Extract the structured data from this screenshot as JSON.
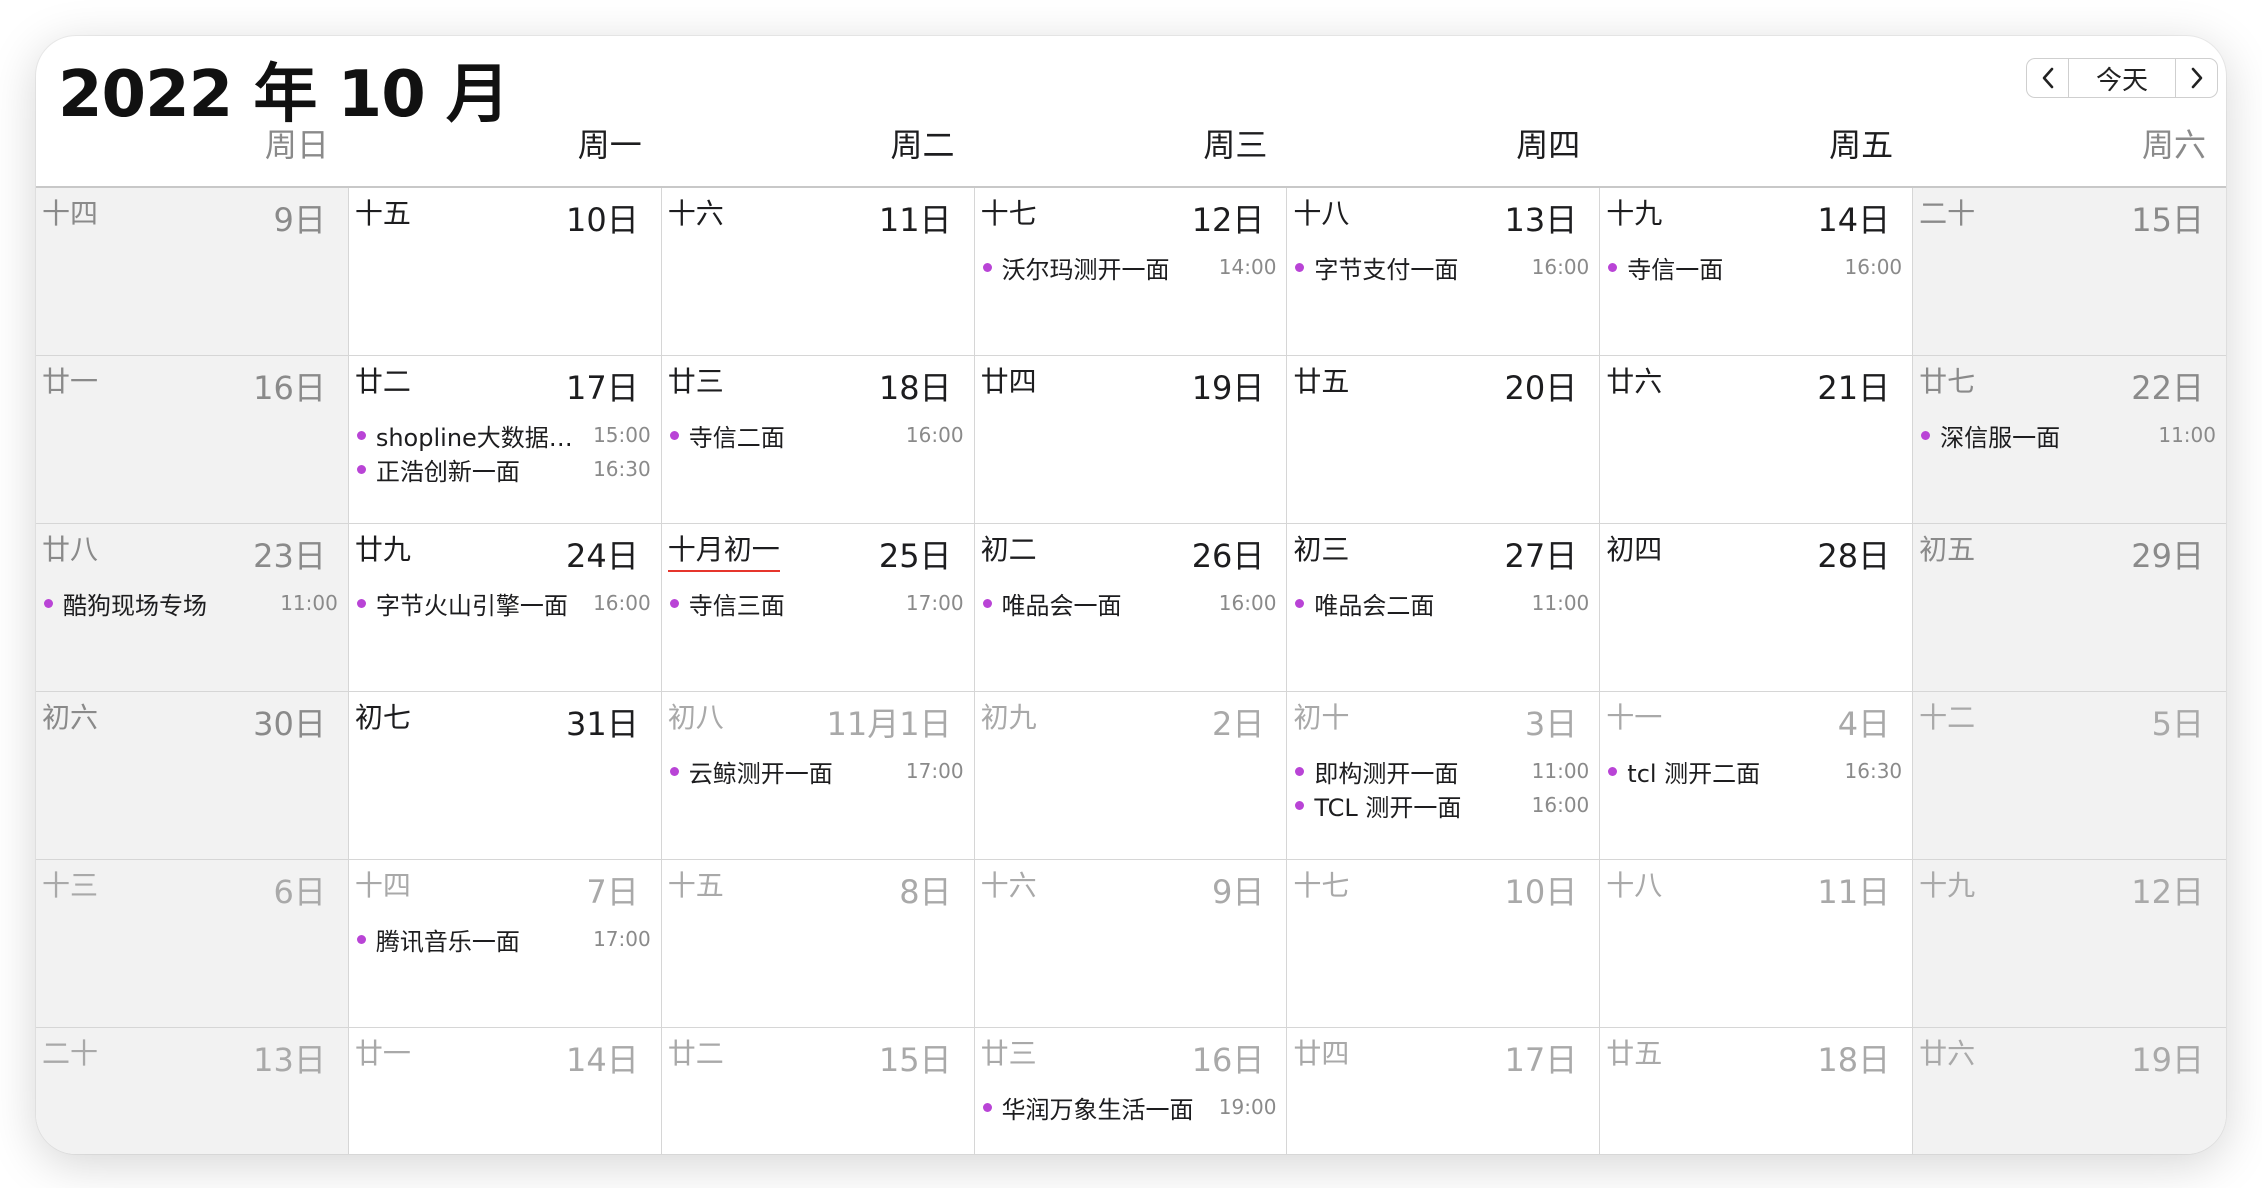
{
  "header": {
    "title": "2022 年 10 月",
    "today_label": "今天",
    "prev_icon": "chevron-left",
    "next_icon": "chevron-right"
  },
  "weekdays": [
    "周日",
    "周一",
    "周二",
    "周三",
    "周四",
    "周五",
    "周六"
  ],
  "colors": {
    "event_dot": "#b944d6",
    "lunar_first_underline": "#e6352c",
    "weekend_bg": "#f2f2f2"
  },
  "weeks": [
    {
      "days": [
        {
          "lunar": "十四",
          "day": "9日",
          "weekend": true,
          "events": []
        },
        {
          "lunar": "十五",
          "day": "10日",
          "events": []
        },
        {
          "lunar": "十六",
          "day": "11日",
          "events": []
        },
        {
          "lunar": "十七",
          "day": "12日",
          "events": [
            {
              "title": "沃尔玛测开一面",
              "time": "14:00"
            }
          ]
        },
        {
          "lunar": "十八",
          "day": "13日",
          "events": [
            {
              "title": "字节支付一面",
              "time": "16:00"
            }
          ]
        },
        {
          "lunar": "十九",
          "day": "14日",
          "events": [
            {
              "title": "寺信一面",
              "time": "16:00"
            }
          ]
        },
        {
          "lunar": "二十",
          "day": "15日",
          "weekend": true,
          "events": []
        }
      ]
    },
    {
      "days": [
        {
          "lunar": "廿一",
          "day": "16日",
          "weekend": true,
          "events": []
        },
        {
          "lunar": "廿二",
          "day": "17日",
          "events": [
            {
              "title": "shopline大数据…",
              "time": "15:00"
            },
            {
              "title": "正浩创新一面",
              "time": "16:30"
            }
          ]
        },
        {
          "lunar": "廿三",
          "day": "18日",
          "events": [
            {
              "title": "寺信二面",
              "time": "16:00"
            }
          ]
        },
        {
          "lunar": "廿四",
          "day": "19日",
          "events": []
        },
        {
          "lunar": "廿五",
          "day": "20日",
          "events": []
        },
        {
          "lunar": "廿六",
          "day": "21日",
          "events": []
        },
        {
          "lunar": "廿七",
          "day": "22日",
          "weekend": true,
          "events": [
            {
              "title": "深信服一面",
              "time": "11:00"
            }
          ]
        }
      ]
    },
    {
      "days": [
        {
          "lunar": "廿八",
          "day": "23日",
          "weekend": true,
          "events": [
            {
              "title": "酷狗现场专场",
              "time": "11:00"
            }
          ]
        },
        {
          "lunar": "廿九",
          "day": "24日",
          "events": [
            {
              "title": "字节火山引擎一面",
              "time": "16:00"
            }
          ]
        },
        {
          "lunar": "十月初一",
          "day": "25日",
          "lunar_first": true,
          "events": [
            {
              "title": "寺信三面",
              "time": "17:00"
            }
          ]
        },
        {
          "lunar": "初二",
          "day": "26日",
          "events": [
            {
              "title": "唯品会一面",
              "time": "16:00"
            }
          ]
        },
        {
          "lunar": "初三",
          "day": "27日",
          "events": [
            {
              "title": "唯品会二面",
              "time": "11:00"
            }
          ]
        },
        {
          "lunar": "初四",
          "day": "28日",
          "events": []
        },
        {
          "lunar": "初五",
          "day": "29日",
          "weekend": true,
          "events": []
        }
      ]
    },
    {
      "days": [
        {
          "lunar": "初六",
          "day": "30日",
          "weekend": true,
          "events": []
        },
        {
          "lunar": "初七",
          "day": "31日",
          "events": []
        },
        {
          "lunar": "初八",
          "day": "11月1日",
          "other_month": true,
          "events": [
            {
              "title": "云鲸测开一面",
              "time": "17:00"
            }
          ]
        },
        {
          "lunar": "初九",
          "day": "2日",
          "other_month": true,
          "events": []
        },
        {
          "lunar": "初十",
          "day": "3日",
          "other_month": true,
          "events": [
            {
              "title": "即构测开一面",
              "time": "11:00"
            },
            {
              "title": "TCL 测开一面",
              "time": "16:00"
            }
          ]
        },
        {
          "lunar": "十一",
          "day": "4日",
          "other_month": true,
          "events": [
            {
              "title": "tcl 测开二面",
              "time": "16:30"
            }
          ]
        },
        {
          "lunar": "十二",
          "day": "5日",
          "weekend": true,
          "other_month": true,
          "events": []
        }
      ]
    },
    {
      "days": [
        {
          "lunar": "十三",
          "day": "6日",
          "weekend": true,
          "other_month": true,
          "events": []
        },
        {
          "lunar": "十四",
          "day": "7日",
          "other_month": true,
          "events": [
            {
              "title": "腾讯音乐一面",
              "time": "17:00"
            }
          ]
        },
        {
          "lunar": "十五",
          "day": "8日",
          "other_month": true,
          "events": []
        },
        {
          "lunar": "十六",
          "day": "9日",
          "other_month": true,
          "events": []
        },
        {
          "lunar": "十七",
          "day": "10日",
          "other_month": true,
          "events": []
        },
        {
          "lunar": "十八",
          "day": "11日",
          "other_month": true,
          "events": []
        },
        {
          "lunar": "十九",
          "day": "12日",
          "weekend": true,
          "other_month": true,
          "events": []
        }
      ]
    },
    {
      "days": [
        {
          "lunar": "二十",
          "day": "13日",
          "weekend": true,
          "other_month": true,
          "events": []
        },
        {
          "lunar": "廿一",
          "day": "14日",
          "other_month": true,
          "events": []
        },
        {
          "lunar": "廿二",
          "day": "15日",
          "other_month": true,
          "events": []
        },
        {
          "lunar": "廿三",
          "day": "16日",
          "other_month": true,
          "events": [
            {
              "title": "华润万象生活一面",
              "time": "19:00"
            }
          ]
        },
        {
          "lunar": "廿四",
          "day": "17日",
          "other_month": true,
          "events": []
        },
        {
          "lunar": "廿五",
          "day": "18日",
          "other_month": true,
          "events": []
        },
        {
          "lunar": "廿六",
          "day": "19日",
          "weekend": true,
          "other_month": true,
          "events": []
        }
      ]
    }
  ]
}
